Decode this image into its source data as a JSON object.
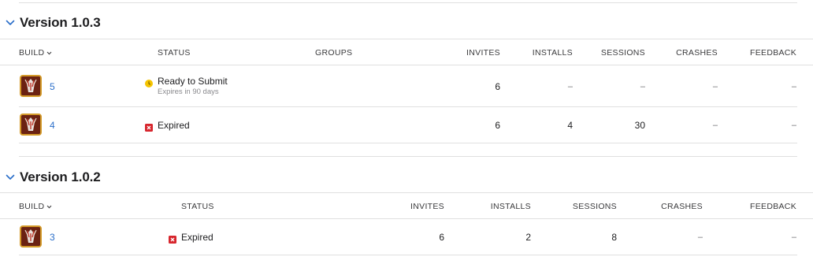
{
  "versions": [
    {
      "title": "Version 1.0.3",
      "columns": {
        "build": "BUILD",
        "status": "STATUS",
        "groups": "GROUPS",
        "invites": "INVITES",
        "installs": "INSTALLS",
        "sessions": "SESSIONS",
        "crashes": "CRASHES",
        "feedback": "FEEDBACK"
      },
      "builds": [
        {
          "number": "5",
          "status": "Ready to Submit",
          "status_sub": "Expires in 90 days",
          "status_type": "ready",
          "invites": "6",
          "installs": "–",
          "sessions": "–",
          "crashes": "–",
          "feedback": "–"
        },
        {
          "number": "4",
          "status": "Expired",
          "status_sub": "",
          "status_type": "expired",
          "invites": "6",
          "installs": "4",
          "sessions": "30",
          "crashes": "–",
          "feedback": "–"
        }
      ]
    },
    {
      "title": "Version 1.0.2",
      "columns": {
        "build": "BUILD",
        "status": "STATUS",
        "invites": "INVITES",
        "installs": "INSTALLS",
        "sessions": "SESSIONS",
        "crashes": "CRASHES",
        "feedback": "FEEDBACK"
      },
      "builds": [
        {
          "number": "3",
          "status": "Expired",
          "status_type": "expired",
          "invites": "6",
          "installs": "2",
          "sessions": "8",
          "crashes": "–",
          "feedback": "–"
        }
      ]
    }
  ],
  "icons": {
    "collapse": "chevron-down-icon",
    "sort": "chevron-down-icon",
    "ready": "clock-circle-icon",
    "expired": "x-square-icon",
    "app": "app-icon"
  },
  "colors": {
    "link": "#2a6ec9",
    "ready": "#f5c400",
    "expired": "#d7262d",
    "chevron": "#2a6ec9"
  }
}
